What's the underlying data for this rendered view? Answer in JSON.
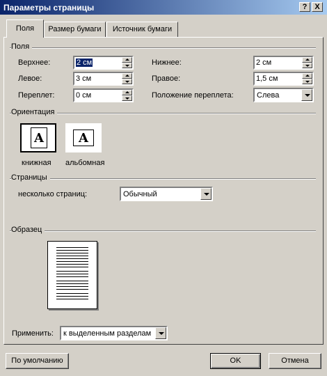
{
  "window": {
    "title": "Параметры страницы",
    "help_glyph": "?",
    "close_glyph": "X"
  },
  "tabs": [
    {
      "label": "Поля",
      "active": true
    },
    {
      "label": "Размер бумаги",
      "active": false
    },
    {
      "label": "Источник бумаги",
      "active": false
    }
  ],
  "margins": {
    "group_label": "Поля",
    "top": {
      "label": "Верхнее:",
      "value": "2 см"
    },
    "bottom": {
      "label": "Нижнее:",
      "value": "2 см"
    },
    "left": {
      "label": "Левое:",
      "value": "3 см"
    },
    "right": {
      "label": "Правое:",
      "value": "1,5 см"
    },
    "gutter": {
      "label": "Переплет:",
      "value": "0 см"
    },
    "gutter_position": {
      "label": "Положение переплета:",
      "value": "Слева"
    }
  },
  "orientation": {
    "group_label": "Ориентация",
    "portrait": {
      "label": "книжная",
      "glyph": "A",
      "selected": true
    },
    "landscape": {
      "label": "альбомная",
      "glyph": "A",
      "selected": false
    }
  },
  "pages": {
    "group_label": "Страницы",
    "multiple_label": "несколько страниц:",
    "multiple_value": "Обычный"
  },
  "preview": {
    "group_label": "Образец",
    "apply_label": "Применить:",
    "apply_value": "к выделенным разделам"
  },
  "buttons": {
    "default_label": "По умолчанию",
    "ok_label": "OK",
    "cancel_label": "Отмена"
  },
  "colors": {
    "titlebar_start": "#0a246a",
    "titlebar_end": "#a6caf0",
    "face": "#d4d0c8",
    "selection": "#0a246a"
  }
}
